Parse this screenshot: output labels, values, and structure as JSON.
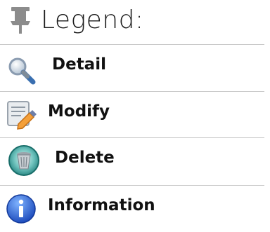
{
  "legend": {
    "title": "Legend:",
    "title_icon": "pushpin-icon",
    "items": [
      {
        "label": "Detail",
        "icon": "magnifier-icon"
      },
      {
        "label": "Modify",
        "icon": "edit-document-icon"
      },
      {
        "label": "Delete",
        "icon": "trash-bin-icon"
      },
      {
        "label": "Information",
        "icon": "info-icon"
      }
    ]
  },
  "colors": {
    "divider": "#c9c9c9",
    "pin": "#8a8a8a",
    "info_blue": "#1d5fd0",
    "trash_teal": "#1f8f8c"
  }
}
